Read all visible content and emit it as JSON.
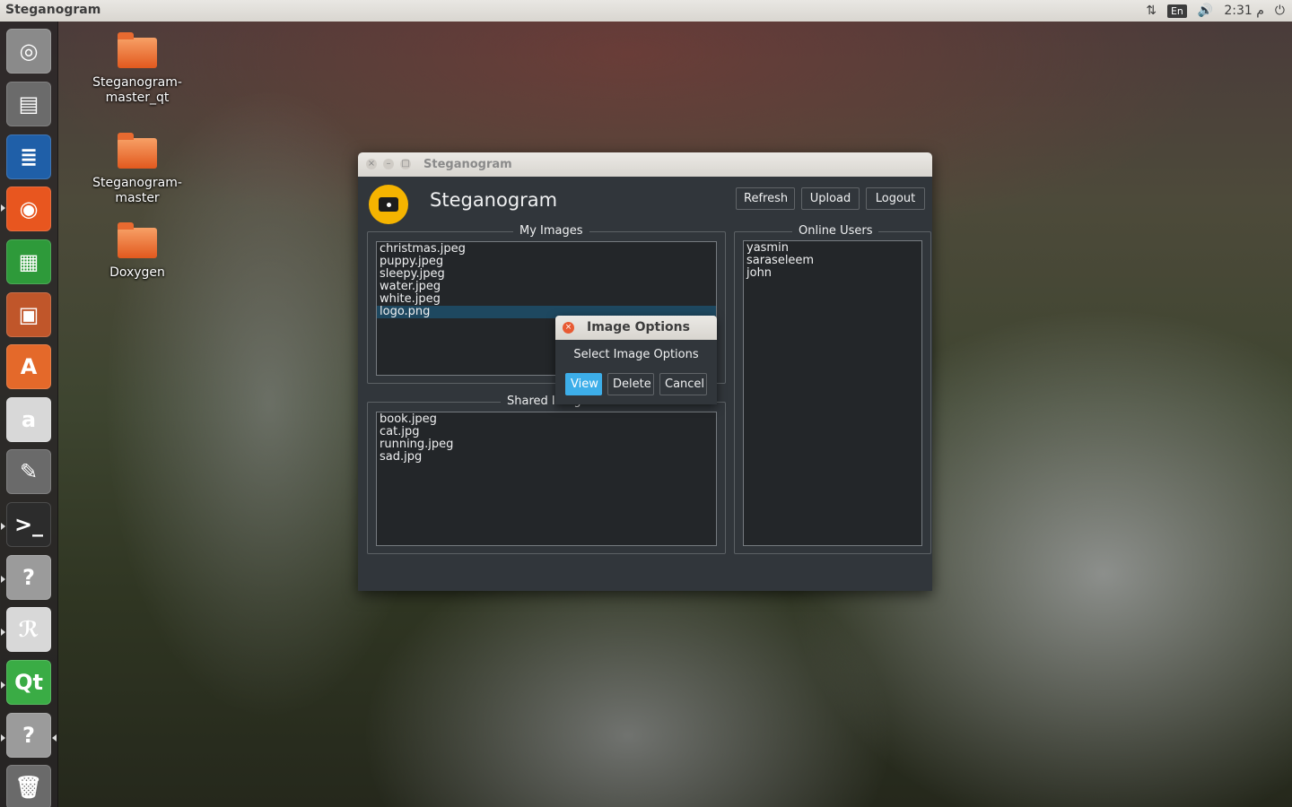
{
  "top_panel": {
    "app_title": "Steganogram",
    "keyboard_layout": "En",
    "clock": "م 2:31"
  },
  "launcher": {
    "items": [
      {
        "name": "ubuntu-dash-icon",
        "glyph": "◎",
        "color": "#8a8a8a"
      },
      {
        "name": "files-icon",
        "glyph": "▤",
        "color": "#6b6b6b"
      },
      {
        "name": "libreoffice-writer-icon",
        "glyph": "≣",
        "color": "#1f5fa8"
      },
      {
        "name": "firefox-icon",
        "glyph": "◉",
        "color": "#e8561f"
      },
      {
        "name": "libreoffice-calc-icon",
        "glyph": "▦",
        "color": "#2e9a3a"
      },
      {
        "name": "libreoffice-impress-icon",
        "glyph": "▣",
        "color": "#c0562a"
      },
      {
        "name": "software-center-icon",
        "glyph": "A",
        "color": "#e4692a"
      },
      {
        "name": "amazon-icon",
        "glyph": "a",
        "color": "#d8d8d8"
      },
      {
        "name": "system-settings-icon",
        "glyph": "✎",
        "color": "#6a6a6a"
      },
      {
        "name": "terminal-icon",
        "glyph": ">_",
        "color": "#2c2c2c"
      },
      {
        "name": "unknown-app-icon",
        "glyph": "?",
        "color": "#9b9b9b"
      },
      {
        "name": "acrobat-reader-icon",
        "glyph": "ℛ",
        "color": "#d8d8d8"
      },
      {
        "name": "qt-creator-icon",
        "glyph": "Qt",
        "color": "#3aac45"
      },
      {
        "name": "unknown-app-icon",
        "glyph": "?",
        "color": "#9b9b9b"
      },
      {
        "name": "trash-icon",
        "glyph": "🗑",
        "color": "#6a6a6a"
      }
    ]
  },
  "desktop": {
    "icons": [
      {
        "label": "Steganogram-master_qt"
      },
      {
        "label": "Steganogram-master"
      },
      {
        "label": "Doxygen"
      }
    ]
  },
  "window": {
    "title": "Steganogram",
    "heading": "Steganogram",
    "buttons": {
      "refresh": "Refresh",
      "upload": "Upload",
      "logout": "Logout"
    },
    "my_images": {
      "title": "My Images",
      "items": [
        "christmas.jpeg",
        "puppy.jpeg",
        "sleepy.jpeg",
        "water.jpeg",
        "white.jpeg",
        "logo.png"
      ],
      "selected": "logo.png"
    },
    "shared_images": {
      "title": "Shared Images",
      "items": [
        "book.jpeg",
        "cat.jpg",
        "running.jpeg",
        "sad.jpg"
      ]
    },
    "online_users": {
      "title": "Online Users",
      "items": [
        "yasmin",
        "saraseleem",
        "john"
      ]
    }
  },
  "dialog": {
    "title": "Image Options",
    "message": "Select Image Options",
    "buttons": {
      "view": "View",
      "delete": "Delete",
      "cancel": "Cancel"
    }
  },
  "colors": {
    "accent": "#3daee9",
    "selection": "#1e4860",
    "window_bg": "#31363b",
    "list_bg": "#232629",
    "logo_yellow": "#f5b400",
    "close_orange": "#e85a33"
  }
}
